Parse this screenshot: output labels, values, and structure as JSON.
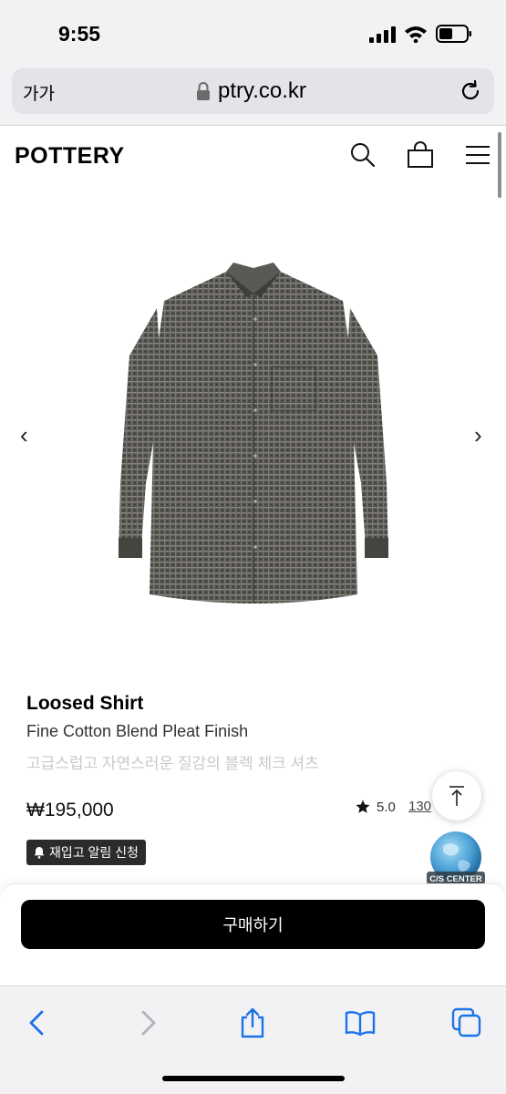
{
  "status_bar": {
    "time": "9:55"
  },
  "browser": {
    "text_size_button": "가가",
    "url": "ptry.co.kr"
  },
  "site": {
    "logo": "POTTERY"
  },
  "product": {
    "name": "Loosed Shirt",
    "subtitle": "Fine Cotton Blend Pleat Finish",
    "description": "고급스럽고 자연스러운 질감의 블렉 체크 셔츠",
    "price": "₩195,000",
    "rating": "5.0",
    "review_count": "130",
    "restock_label": "재입고 알림 신청"
  },
  "floating": {
    "cs_center_label": "C/S CENTER"
  },
  "purchase": {
    "buy_label": "구매하기"
  },
  "colors": {
    "accent": "#000000",
    "product_image": "#4a4a48",
    "cs_badge": "#4fa3d8"
  }
}
